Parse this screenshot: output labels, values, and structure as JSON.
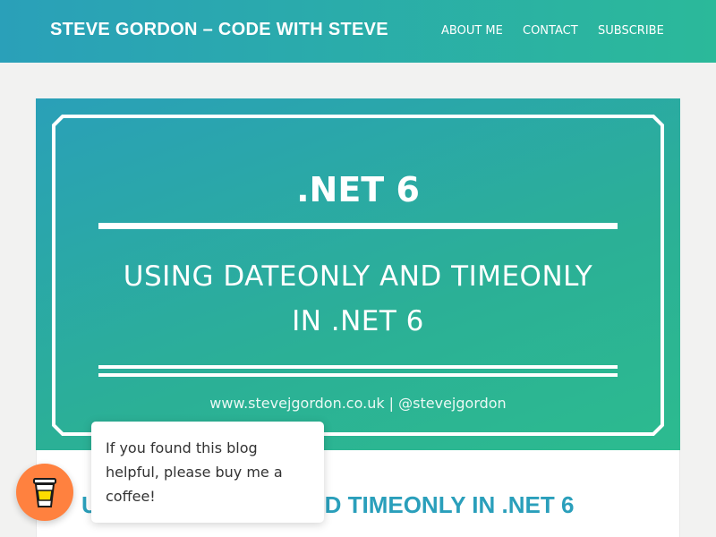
{
  "header": {
    "site_title": "STEVE GORDON – CODE WITH STEVE",
    "nav": [
      "ABOUT ME",
      "CONTACT",
      "SUBSCRIBE"
    ]
  },
  "hero": {
    "heading": ".NET 6",
    "subtitle_line1": "USING DATEONLY AND TIMEONLY",
    "subtitle_line2": "IN .NET 6",
    "footer": "www.stevejgordon.co.uk | @stevejgordon"
  },
  "article": {
    "title": "USING DATEONLY AND TIMEONLY IN .NET 6"
  },
  "tooltip": {
    "text": "If you found this blog helpful, please buy me a coffee!"
  },
  "coffee_button": {
    "icon": "coffee-cup-icon",
    "color": "#ff813f"
  },
  "colors": {
    "header_gradient_start": "#2aa0b9",
    "header_gradient_end": "#2bb99a",
    "title_accent": "#2a9fbb",
    "page_background": "#f2f2f1"
  }
}
